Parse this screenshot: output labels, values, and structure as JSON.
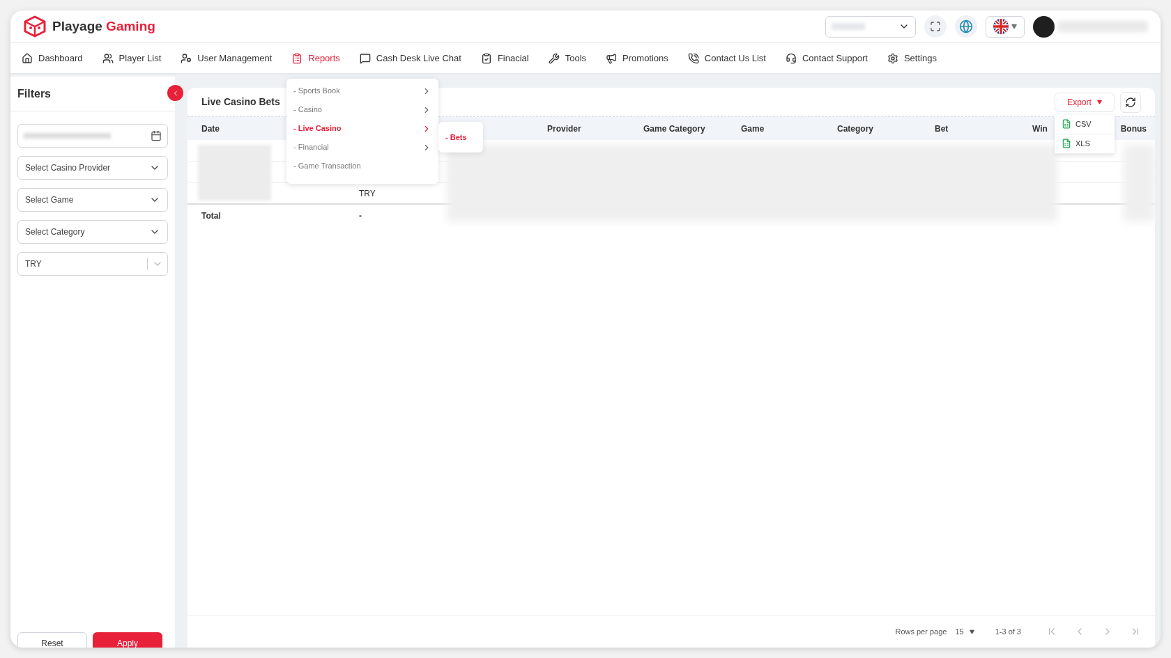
{
  "brand": {
    "first": "Playage",
    "second": "Gaming"
  },
  "nav": [
    {
      "label": "Dashboard",
      "selected": false
    },
    {
      "label": "Player List",
      "selected": false
    },
    {
      "label": "User Management",
      "selected": false
    },
    {
      "label": "Reports",
      "selected": true
    },
    {
      "label": "Cash Desk Live Chat",
      "selected": false
    },
    {
      "label": "Finacial",
      "selected": false
    },
    {
      "label": "Tools",
      "selected": false
    },
    {
      "label": "Promotions",
      "selected": false
    },
    {
      "label": "Contact Us List",
      "selected": false
    },
    {
      "label": "Contact Support",
      "selected": false
    },
    {
      "label": "Settings",
      "selected": false
    }
  ],
  "reports_menu": {
    "items": [
      {
        "label": "- Sports Book",
        "selected": false,
        "has_submenu": true
      },
      {
        "label": "- Casino",
        "selected": false,
        "has_submenu": true
      },
      {
        "label": "- Live Casino",
        "selected": true,
        "has_submenu": true
      },
      {
        "label": "- Financial",
        "selected": false,
        "has_submenu": true
      },
      {
        "label": "- Game Transaction",
        "selected": false,
        "has_submenu": false
      }
    ],
    "submenu": [
      {
        "label": "- Bets",
        "selected": true
      }
    ]
  },
  "filters": {
    "title": "Filters",
    "selects": [
      {
        "placeholder": "Select Casino Provider"
      },
      {
        "placeholder": "Select Game"
      },
      {
        "placeholder": "Select Category"
      }
    ],
    "currency": "TRY",
    "buttons": [
      {
        "label": "Reset",
        "kind": "secondary"
      },
      {
        "label": "Apply",
        "kind": "primary"
      }
    ]
  },
  "report": {
    "title": "Live Casino Bets",
    "export": {
      "label": "Export",
      "options": [
        "CSV",
        "XLS"
      ]
    },
    "columns": [
      "Date",
      "",
      "Provider",
      "Game Category",
      "Game",
      "Category",
      "Bet",
      "Win",
      "Bonus"
    ],
    "rows": [
      [
        "",
        "",
        "",
        "",
        "",
        "",
        "",
        "",
        ""
      ],
      [
        "",
        "",
        "",
        "",
        "",
        "",
        "",
        "",
        ""
      ],
      [
        "",
        "TRY",
        "",
        "",
        "",
        "",
        "",
        "",
        ""
      ]
    ],
    "total": {
      "label": "Total",
      "value": "-"
    }
  },
  "pagination": {
    "rows_per_page_label": "Rows per page",
    "rows_per_page": "15",
    "range": "1-3 of 3"
  }
}
